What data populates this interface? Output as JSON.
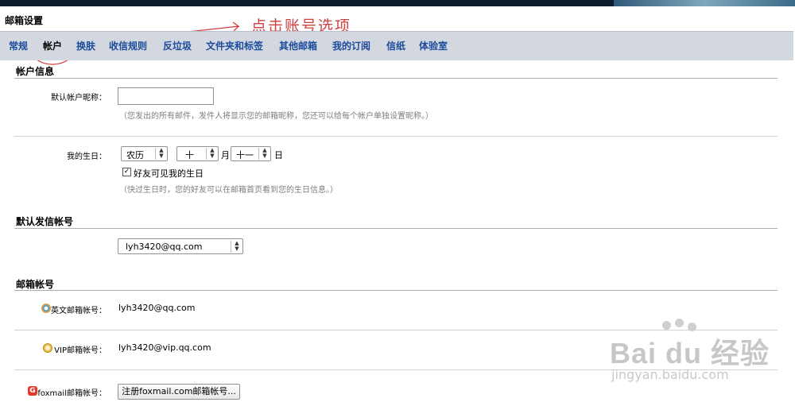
{
  "page": {
    "title": "邮箱设置"
  },
  "annotation": {
    "text": "点击账号选项"
  },
  "tabs": [
    "常规",
    "帐户",
    "换肤",
    "收信规则",
    "反垃圾",
    "文件夹和标签",
    "其他邮箱",
    "我的订阅",
    "信纸",
    "体验室"
  ],
  "active_tab": "帐户",
  "account_info": {
    "title": "帐户信息",
    "nickname_label": "默认帐户昵称：",
    "nickname_value": "",
    "nickname_hint": "（您发出的所有邮件，发件人将显示您的邮箱昵称，您还可以给每个帐户单独设置昵称。）",
    "birthday_label": "我的生日：",
    "calendar_select": "农历",
    "month_select": "十",
    "month_unit": "月",
    "day_select": "十一",
    "day_unit": "日",
    "friends_visible_checked": true,
    "friends_visible_label": "好友可见我的生日",
    "birthday_hint": "（快过生日时，您的好友可以在邮箱首页看到您的生日信息。）"
  },
  "default_sender": {
    "title": "默认发信帐号",
    "selected": "lyh3420@qq.com"
  },
  "mail_accounts": {
    "title": "邮箱帐号",
    "english_label": "英文邮箱帐号：",
    "english_value": "lyh3420@qq.com",
    "vip_label": "VIP邮箱帐号：",
    "vip_value": "lyh3420@vip.qq.com",
    "foxmail_label": "foxmail邮箱帐号：",
    "foxmail_button": "注册foxmail.com邮箱帐号..."
  },
  "watermark": {
    "logo": "Bai du 经验",
    "url": "jingyan.baidu.com"
  },
  "colors": {
    "tab_text": "#1b4b9b",
    "tab_bar": "#d3d7e0",
    "annotation": "#d0403f",
    "hint": "#7e7e7e"
  }
}
